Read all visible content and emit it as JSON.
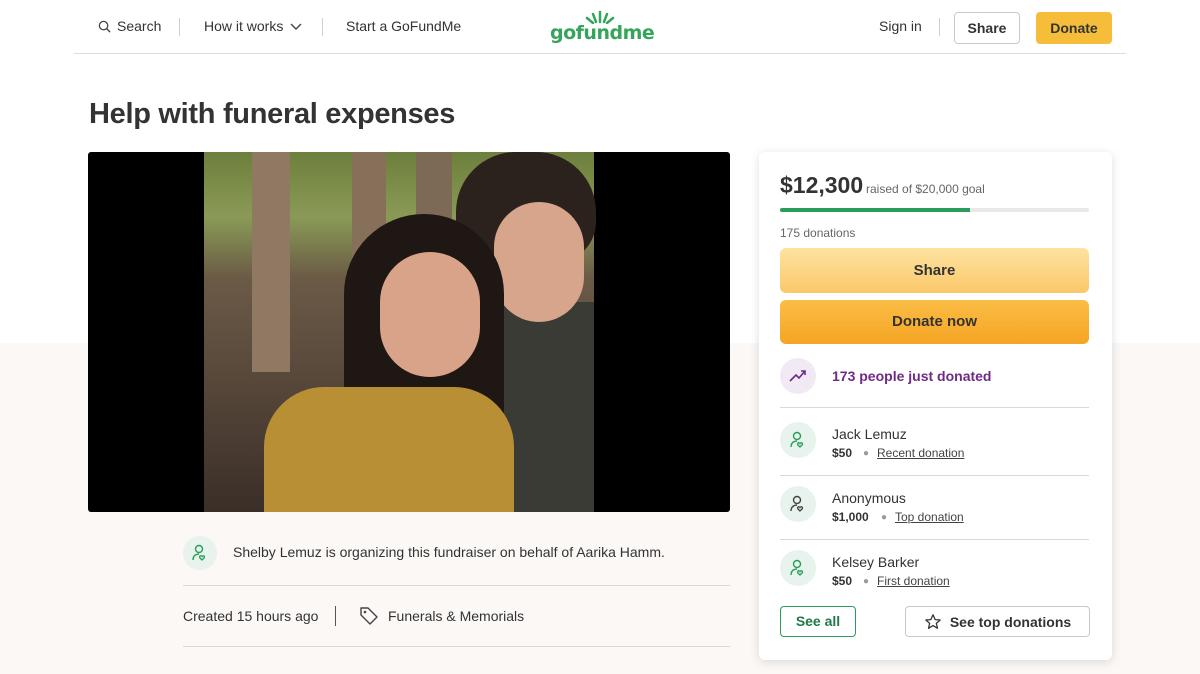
{
  "header": {
    "search_label": "Search",
    "how_it_works_label": "How it works",
    "start_label": "Start a GoFundMe",
    "logo_text": "gofundme",
    "sign_in_label": "Sign in",
    "share_label": "Share",
    "donate_label": "Donate"
  },
  "campaign": {
    "title": "Help with funeral expenses",
    "organizer_text": "Shelby Lemuz is organizing this fundraiser on behalf of Aarika Hamm.",
    "created": "Created 15 hours ago",
    "category": "Funerals & Memorials"
  },
  "card": {
    "raised": "$12,300",
    "goal_text": "raised of $20,000 goal",
    "progress_fraction": 0.615,
    "donations_count": "175 donations",
    "share_label": "Share",
    "donate_label": "Donate now",
    "just_donated": "173 people just donated",
    "donors": [
      {
        "name": "Jack Lemuz",
        "amount": "$50",
        "type": "Recent donation"
      },
      {
        "name": "Anonymous",
        "amount": "$1,000",
        "type": "Top donation"
      },
      {
        "name": "Kelsey Barker",
        "amount": "$50",
        "type": "First donation"
      }
    ],
    "see_all_label": "See all",
    "see_top_label": "See top donations"
  },
  "colors": {
    "brand_green": "#36a55c",
    "donate_orange": "#f5bd3a",
    "trend_purple": "#6f2a84",
    "progress_green": "#2a9d5c"
  },
  "icons": [
    "search-icon",
    "chevron-down-icon",
    "logo-sprout-icon",
    "user-heart-icon",
    "tag-icon",
    "trending-up-icon",
    "star-icon"
  ]
}
